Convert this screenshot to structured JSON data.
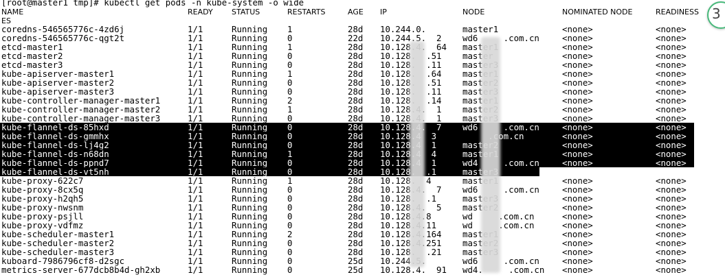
{
  "terminal": {
    "prompt": "[root@master1 tmp]# kubectl get pods -n kube-system -o wide",
    "header": {
      "name": "NAME",
      "ready": "READY",
      "status": "STATUS",
      "restarts": "RESTARTS",
      "age": "AGE",
      "ip": "IP",
      "node": "NODE",
      "nominated": "NOMINATED NODE",
      "readiness": "READINESS",
      "wrap": "ES"
    },
    "rows": [
      {
        "name": "coredns-546565776c-4zd6j",
        "ready": "1/1",
        "status": "Running",
        "restarts": "1",
        "age": "28d",
        "ip": "10.244.0.",
        "node": "master1",
        "nominated": "<none>",
        "readiness": "<none>"
      },
      {
        "name": "coredns-546565776c-qgt2t",
        "ready": "1/1",
        "status": "Running",
        "restarts": "0",
        "age": "22d",
        "ip": "10.244.5.  2",
        "node": "wd6     .com.cn",
        "nominated": "<none>",
        "readiness": "<none>"
      },
      {
        "name": "etcd-master1",
        "ready": "1/1",
        "status": "Running",
        "restarts": "1",
        "age": "28d",
        "ip": "10.128.4.  64",
        "node": "master1",
        "nominated": "<none>",
        "readiness": "<none>"
      },
      {
        "name": "etcd-master2",
        "ready": "1/1",
        "status": "Running",
        "restarts": "0",
        "age": "28d",
        "ip": "10.128.  .51",
        "node": "master",
        "nominated": "<none>",
        "readiness": "<none>"
      },
      {
        "name": "etcd-master3",
        "ready": "1/1",
        "status": "Running",
        "restarts": "0",
        "age": "28d",
        "ip": "10.128.  .11",
        "node": "master3",
        "nominated": "<none>",
        "readiness": "<none>"
      },
      {
        "name": "kube-apiserver-master1",
        "ready": "1/1",
        "status": "Running",
        "restarts": "1",
        "age": "28d",
        "ip": "10.128.  .64",
        "node": "master1",
        "nominated": "<none>",
        "readiness": "<none>"
      },
      {
        "name": "kube-apiserver-master2",
        "ready": "1/1",
        "status": "Running",
        "restarts": "0",
        "age": "28d",
        "ip": "10.128.  .51",
        "node": "master2",
        "nominated": "<none>",
        "readiness": "<none>"
      },
      {
        "name": "kube-apiserver-master3",
        "ready": "1/1",
        "status": "Running",
        "restarts": "0",
        "age": "28d",
        "ip": "10.128.  .11",
        "node": "master3",
        "nominated": "<none>",
        "readiness": "<none>"
      },
      {
        "name": "kube-controller-manager-master1",
        "ready": "1/1",
        "status": "Running",
        "restarts": "2",
        "age": "28d",
        "ip": "10.128.  .14",
        "node": "master1",
        "nominated": "<none>",
        "readiness": "<none>"
      },
      {
        "name": "kube-controller-manager-master2",
        "ready": "1/1",
        "status": "Running",
        "restarts": "1",
        "age": "28d",
        "ip": "10.128.4.  1",
        "node": "master2",
        "nominated": "<none>",
        "readiness": "<none>"
      },
      {
        "name": "kube-controller-manager-master3",
        "ready": "1/1",
        "status": "Running",
        "restarts": "0",
        "age": "28d",
        "ip": "10.128.4.  1",
        "node": "master3",
        "nominated": "<none>",
        "readiness": "<none>"
      },
      {
        "name": "kube-flannel-ds-85hxd",
        "ready": "1/1",
        "status": "Running",
        "restarts": "0",
        "age": "28d",
        "ip": "10.128.4.  7",
        "node": "wd6     .com.cn",
        "nominated": "<none>",
        "readiness": "<none>",
        "sel": true
      },
      {
        "name": "kube-flannel-ds-gmmhx",
        "ready": "1/1",
        "status": "Running",
        "restarts": "0",
        "age": "28d",
        "ip": "10.128.4  3",
        "node": "     .com.cn",
        "nominated": "<none>",
        "readiness": "<none>",
        "sel": true
      },
      {
        "name": "kube-flannel-ds-lj4g2",
        "ready": "1/1",
        "status": "Running",
        "restarts": "0",
        "age": "28d",
        "ip": "10.128.4  1",
        "node": "master2",
        "nominated": "<none>",
        "readiness": "<none>",
        "sel": true
      },
      {
        "name": "kube-flannel-ds-n68dn",
        "ready": "1/1",
        "status": "Running",
        "restarts": "1",
        "age": "28d",
        "ip": "10.128.4  4",
        "node": "master1",
        "nominated": "<none>",
        "readiness": "<none>",
        "sel": true
      },
      {
        "name": "kube-flannel-ds-ppnd7",
        "ready": "1/1",
        "status": "Running",
        "restarts": "0",
        "age": "28d",
        "ip": "10.128.4  1",
        "node": "wd4     .com.cn",
        "nominated": "<none>",
        "readiness": "<none>",
        "sel": true
      },
      {
        "name": "kube-flannel-ds-vt5nh",
        "ready": "1/1",
        "status": "Running",
        "restarts": "0",
        "age": "28d",
        "ip": "10.128.  .1",
        "node": "master3",
        "nominated": "<none>",
        "readiness": "<none>",
        "sel": "edge"
      },
      {
        "name": "kube-proxy-622c7",
        "ready": "1/1",
        "status": "Running",
        "restarts": "1",
        "age": "28d",
        "ip": "10.128.  4",
        "node": "master1",
        "nominated": "<none>",
        "readiness": "<none>"
      },
      {
        "name": "kube-proxy-8cx5q",
        "ready": "1/1",
        "status": "Running",
        "restarts": "0",
        "age": "28d",
        "ip": "10.128.4.  7",
        "node": "wd6     .com.cn",
        "nominated": "<none>",
        "readiness": "<none>"
      },
      {
        "name": "kube-proxy-h2qh5",
        "ready": "1/1",
        "status": "Running",
        "restarts": "0",
        "age": "28d",
        "ip": "10.128.  .1",
        "node": "master3",
        "nominated": "<none>",
        "readiness": "<none>"
      },
      {
        "name": "kube-proxy-nwsnm",
        "ready": "1/1",
        "status": "Running",
        "restarts": "0",
        "age": "28d",
        "ip": "10.128.4.  5",
        "node": "master2",
        "nominated": "<none>",
        "readiness": "<none>"
      },
      {
        "name": "kube-proxy-psjll",
        "ready": "1/1",
        "status": "Running",
        "restarts": "0",
        "age": "28d",
        "ip": "10.128.4.8",
        "node": "wd     .com.cn",
        "nominated": "<none>",
        "readiness": "<none>"
      },
      {
        "name": "kube-proxy-vdfmz",
        "ready": "1/1",
        "status": "Running",
        "restarts": "0",
        "age": "28d",
        "ip": "10.128.4.11",
        "node": "wd     .com.cn",
        "nominated": "<none>",
        "readiness": "<none>"
      },
      {
        "name": "kube-scheduler-master1",
        "ready": "1/1",
        "status": "Running",
        "restarts": "2",
        "age": "28d",
        "ip": "10.128.4.164",
        "node": "master1",
        "nominated": "<none>",
        "readiness": "<none>"
      },
      {
        "name": "kube-scheduler-master2",
        "ready": "1/1",
        "status": "Running",
        "restarts": "0",
        "age": "28d",
        "ip": "10.128.4.251",
        "node": "master2",
        "nominated": "<none>",
        "readiness": "<none>"
      },
      {
        "name": "kube-scheduler-master3",
        "ready": "1/1",
        "status": "Running",
        "restarts": "0",
        "age": "28d",
        "ip": "10.128.  .21",
        "node": "master3",
        "nominated": "<none>",
        "readiness": "<none>"
      },
      {
        "name": "kuboard-7986796cf8-d2sgc",
        "ready": "1/1",
        "status": "Running",
        "restarts": "0",
        "age": "25d",
        "ip": "10.244.5.",
        "node": "wd6     .com.cn",
        "nominated": "<none>",
        "readiness": "<none>"
      },
      {
        "name": "metrics-server-677dcb8b4d-gh2xb",
        "ready": "1/1",
        "status": "Running",
        "restarts": "0",
        "age": "25d",
        "ip": "10.128.4.  91",
        "node": "wd4.     .com.cn",
        "nominated": "<none>",
        "readiness": "<none>"
      }
    ]
  },
  "badge": {
    "count": "3"
  },
  "colors": {
    "selection_bg": "#000000",
    "selection_fg": "#ffffff",
    "badge_accent": "#47b97a"
  }
}
